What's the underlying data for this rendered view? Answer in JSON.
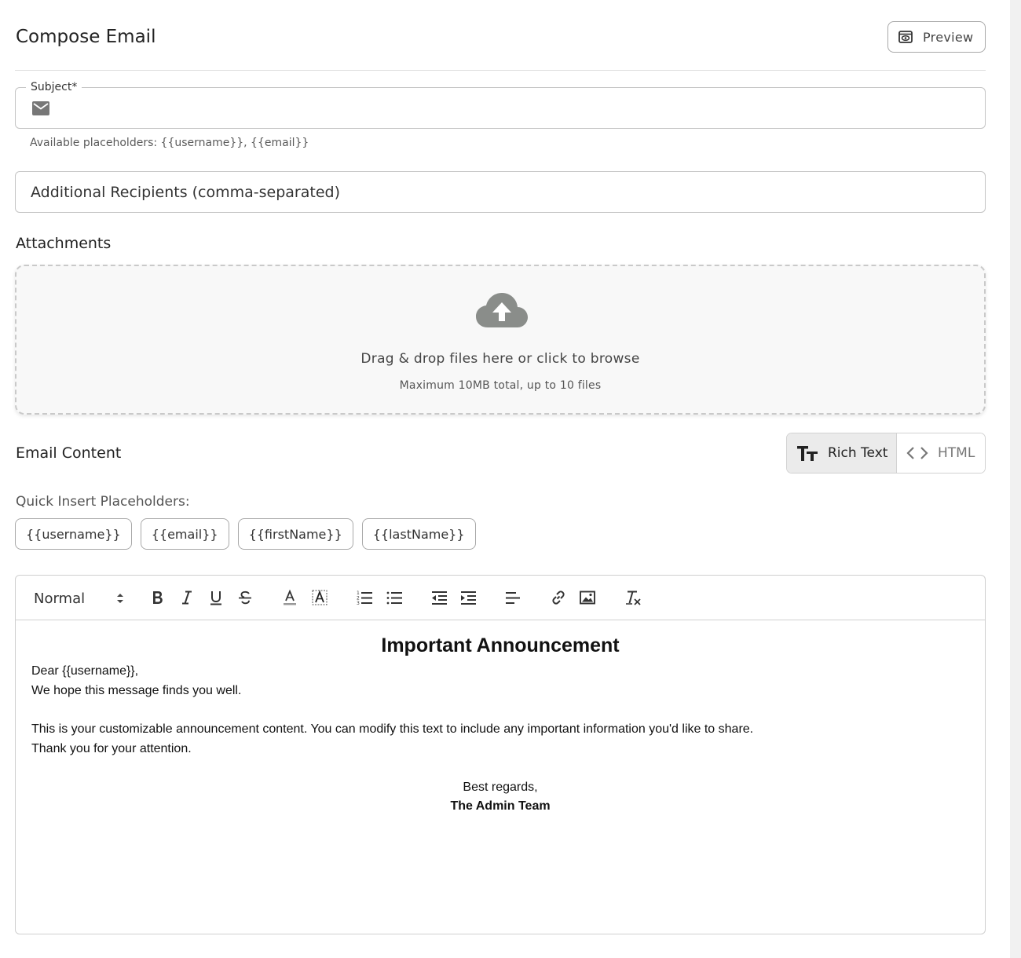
{
  "header": {
    "title": "Compose Email",
    "preview_label": "Preview"
  },
  "subject": {
    "label": "Subject",
    "required_mark": "*",
    "value": "",
    "helper": "Available placeholders: {{username}}, {{email}}"
  },
  "recipients": {
    "placeholder": "Additional Recipients (comma-separated)"
  },
  "attachments": {
    "heading": "Attachments",
    "drop_text": "Drag & drop files here or click to browse",
    "limit_text": "Maximum 10MB total, up to 10 files"
  },
  "email_content": {
    "heading": "Email Content",
    "modes": [
      {
        "label": "Rich Text",
        "active": true
      },
      {
        "label": "HTML",
        "active": false
      }
    ]
  },
  "placeholders": {
    "label": "Quick Insert Placeholders:",
    "chips": [
      "{{username}}",
      "{{email}}",
      "{{firstName}}",
      "{{lastName}}"
    ]
  },
  "toolbar": {
    "format": "Normal"
  },
  "editor_body": {
    "title": "Important Announcement",
    "greeting": "Dear {{username}},",
    "line1": "We hope this message finds you well.",
    "line2": "This is your customizable announcement content. You can modify this text to include any important information you'd like to share.",
    "line3": "Thank you for your attention.",
    "closing": "Best regards,",
    "signature": "The Admin Team"
  },
  "colors": {
    "border": "#c4c4c4",
    "active_mode_bg": "#ebebeb",
    "dropzone_bg": "#f8f8f8",
    "icon_gray": "#888888"
  }
}
